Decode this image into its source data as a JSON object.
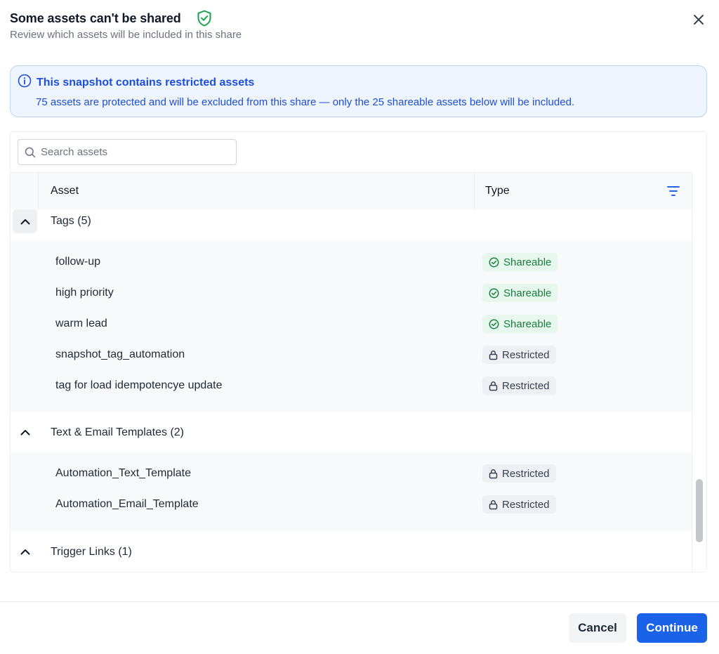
{
  "dialog": {
    "title": "Some assets can't be shared",
    "subtitle": "Review which assets will be included in this share"
  },
  "alert": {
    "title": "This snapshot contains restricted assets",
    "body": "75 assets are protected and will be excluded from this share — only the 25 shareable assets below will be included."
  },
  "search": {
    "placeholder": "Search assets"
  },
  "table": {
    "columns": {
      "asset": "Asset",
      "type": "Type"
    },
    "groups": [
      {
        "label": "Tags (5)",
        "items": [
          {
            "name": "follow-up",
            "status": "Shareable"
          },
          {
            "name": "high priority",
            "status": "Shareable"
          },
          {
            "name": "warm lead",
            "status": "Shareable"
          },
          {
            "name": "snapshot_tag_automation",
            "status": "Restricted"
          },
          {
            "name": "tag for load idempotencye update",
            "status": "Restricted"
          }
        ]
      },
      {
        "label": "Text & Email Templates (2)",
        "items": [
          {
            "name": "Automation_Text_Template",
            "status": "Restricted"
          },
          {
            "name": "Automation_Email_Template",
            "status": "Restricted"
          }
        ]
      },
      {
        "label": "Trigger Links (1)",
        "items": []
      }
    ]
  },
  "footer": {
    "cancel_label": "Cancel",
    "continue_label": "Continue"
  },
  "colors": {
    "primary": "#1a62e8",
    "shareable": "#15803d",
    "alert_text": "#1d4ed8"
  }
}
